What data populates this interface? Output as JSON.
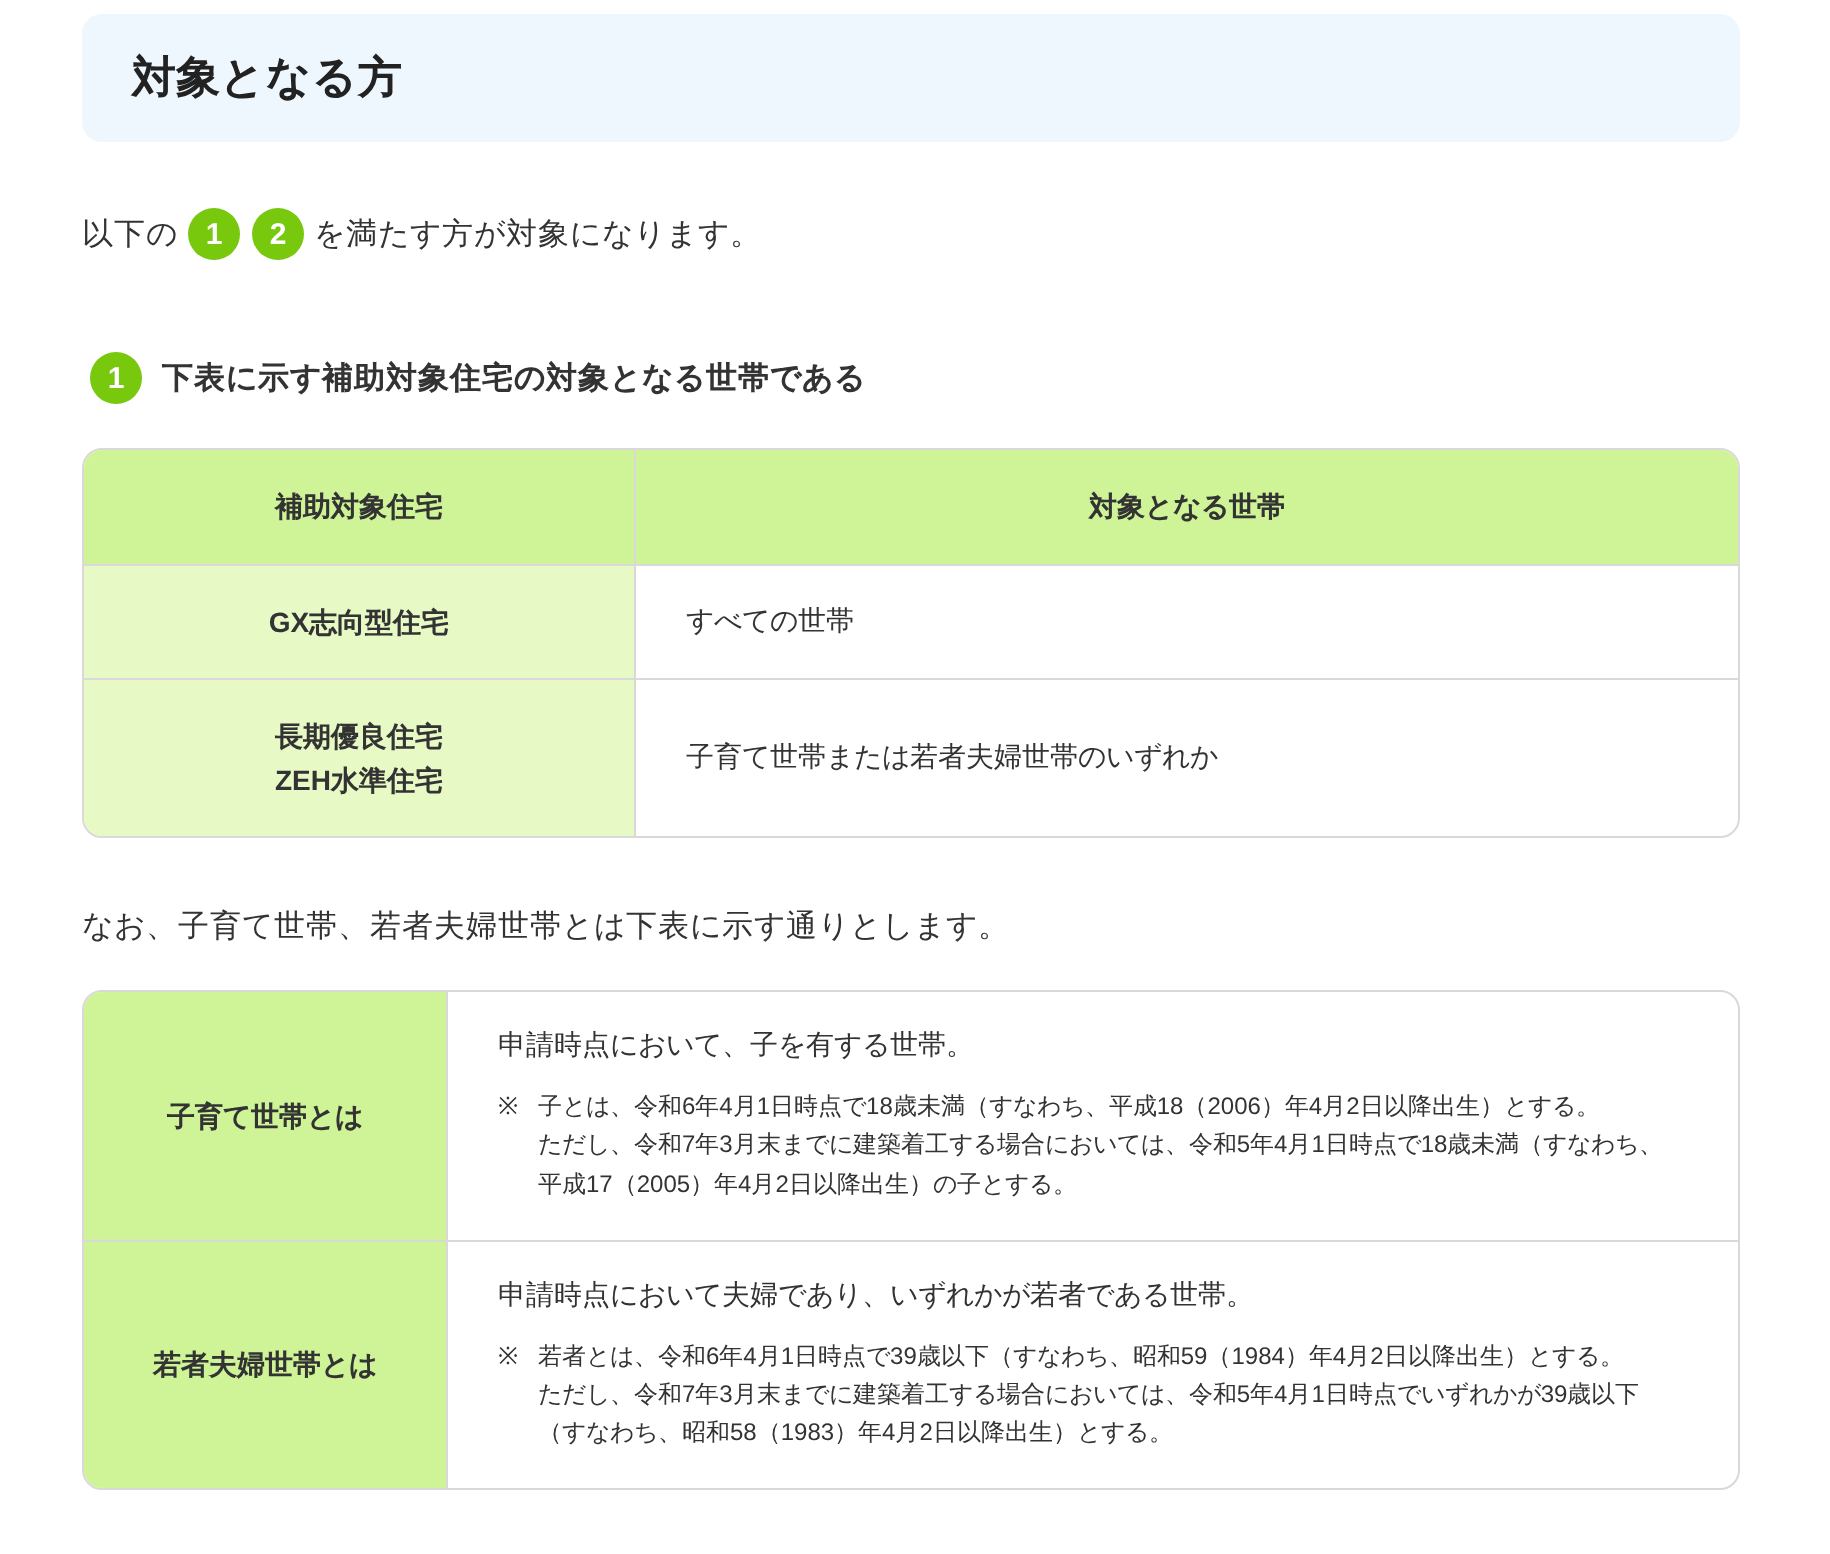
{
  "title": "対象となる方",
  "intro": {
    "before": "以下の",
    "badges": [
      "1",
      "2"
    ],
    "after": "を満たす方が対象になります。"
  },
  "section": {
    "badge": "1",
    "heading": "下表に示す補助対象住宅の対象となる世帯である"
  },
  "housing_table": {
    "columns": [
      "補助対象住宅",
      "対象となる世帯"
    ],
    "rows": [
      {
        "housing": [
          "GX志向型住宅"
        ],
        "households": "すべての世帯"
      },
      {
        "housing": [
          "長期優良住宅",
          "ZEH水準住宅"
        ],
        "households": "子育て世帯または若者夫婦世帯のいずれか"
      }
    ]
  },
  "note_paragraph": "なお、子育て世帯、若者夫婦世帯とは下表に示す通りとします。",
  "definitions": [
    {
      "term": "子育て世帯とは",
      "definition": "申請時点において、子を有する世帯。",
      "note_mark": "※",
      "note_lines": [
        "子とは、令和6年4月1日時点で18歳未満（すなわち、平成18（2006）年4月2日以降出生）とする。",
        "ただし、令和7年3月末までに建築着工する場合においては、令和5年4月1日時点で18歳未満（すなわち、平成17（2005）年4月2日以降出生）の子とする。"
      ]
    },
    {
      "term": "若者夫婦世帯とは",
      "definition": "申請時点において夫婦であり、いずれかが若者である世帯。",
      "note_mark": "※",
      "note_lines": [
        "若者とは、令和6年4月1日時点で39歳以下（すなわち、昭和59（1984）年4月2日以降出生）とする。",
        "ただし、令和7年3月末までに建築着工する場合においては、令和5年4月1日時点でいずれかが39歳以下（すなわち、昭和58（1983）年4月2日以降出生）とする。"
      ]
    }
  ]
}
